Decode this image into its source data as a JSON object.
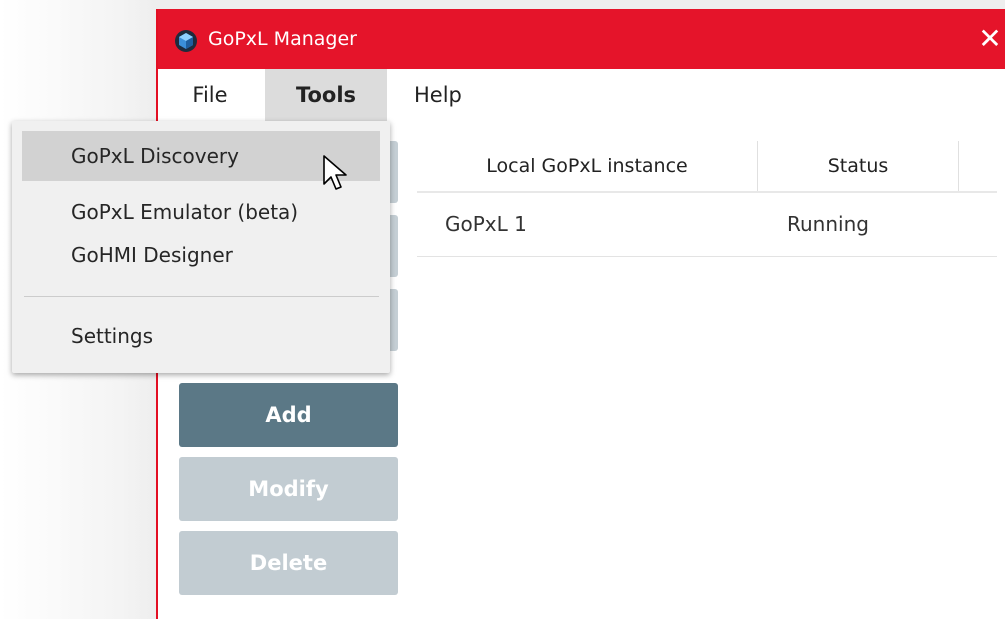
{
  "window": {
    "title": "GoPxL Manager",
    "close_glyph": "✕",
    "accent_color": "#e5142a"
  },
  "menubar": {
    "file": "File",
    "tools": "Tools",
    "help": "Help"
  },
  "tools_menu": {
    "items": [
      {
        "label": "GoPxL Discovery",
        "highlighted": true
      },
      {
        "label": "GoPxL Emulator (beta)",
        "highlighted": false
      },
      {
        "label": "GoHMI Designer",
        "highlighted": false
      },
      {
        "label": "Settings",
        "highlighted": false
      }
    ]
  },
  "table": {
    "columns": [
      "Local GoPxL instance",
      "Status"
    ],
    "rows": [
      {
        "name": "GoPxL 1",
        "status": "Running"
      }
    ]
  },
  "buttons": {
    "add": "Add",
    "modify": "Modify",
    "delete": "Delete",
    "add_color": "#5b7886",
    "disabled_color": "#c2ccd2"
  },
  "icons": {
    "app": "gopxl-logo-icon",
    "cursor": "mouse-pointer-icon"
  }
}
